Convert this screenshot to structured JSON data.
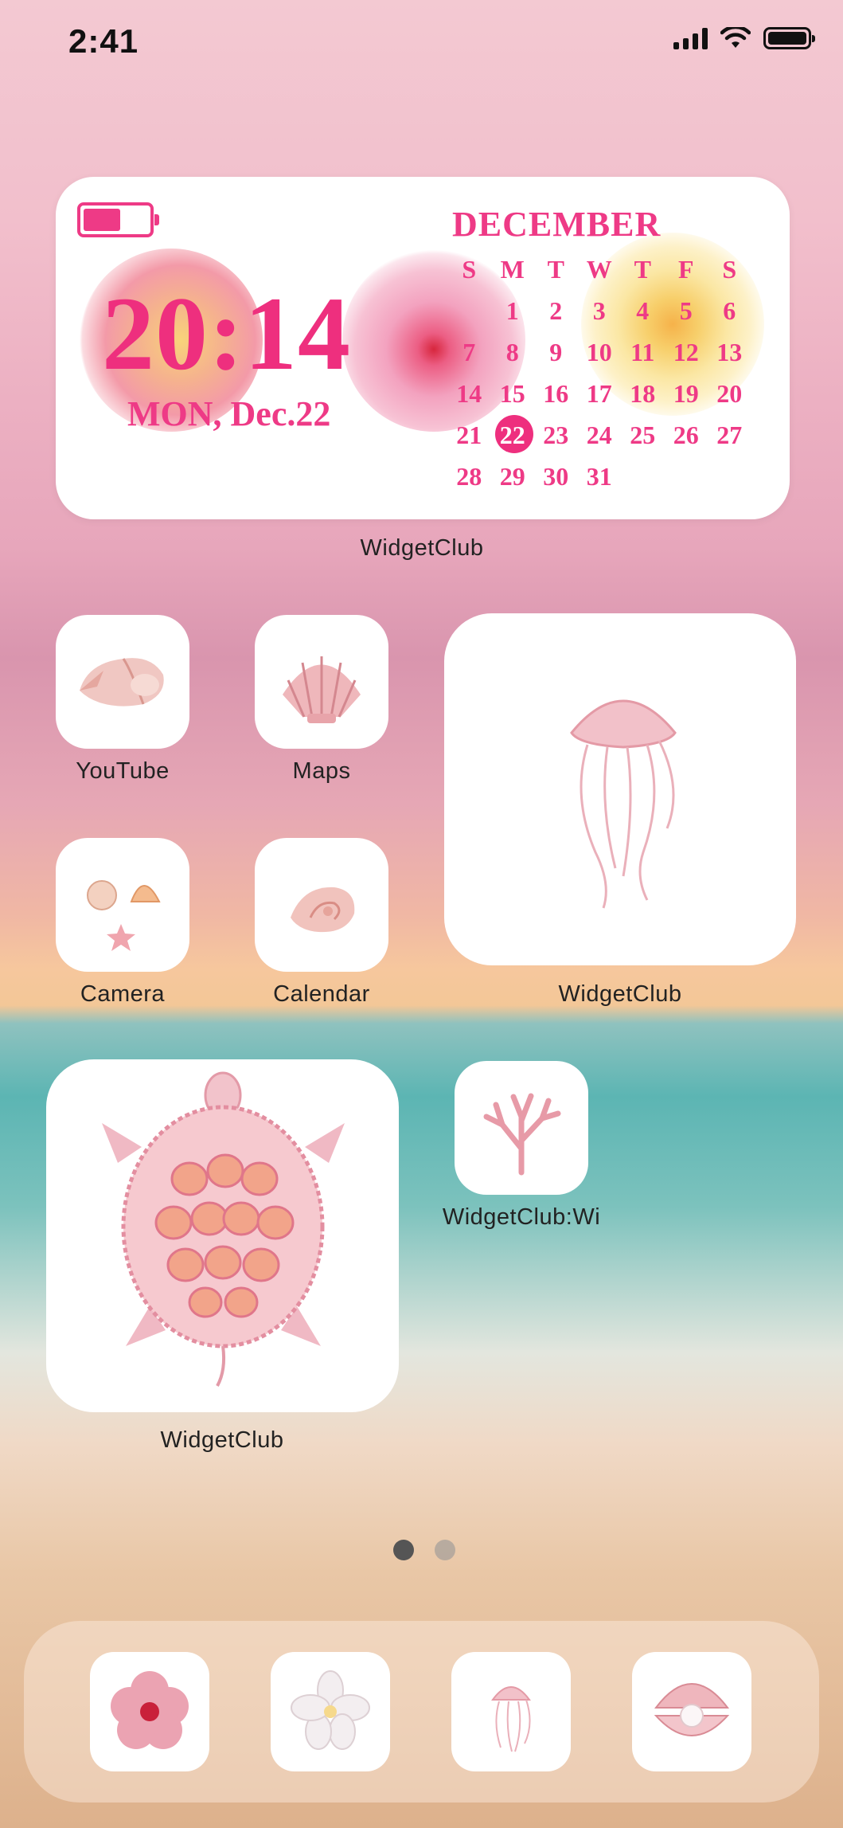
{
  "status_bar": {
    "time": "2:41",
    "icons": [
      "cellular-signal-icon",
      "wifi-icon",
      "battery-icon"
    ]
  },
  "calendar_widget": {
    "clock": "20:14",
    "date": "MON, Dec.22",
    "month": "DECEMBER",
    "weekdays": [
      "S",
      "M",
      "T",
      "W",
      "T",
      "F",
      "S"
    ],
    "days": [
      "",
      "1",
      "2",
      "3",
      "4",
      "5",
      "6",
      "7",
      "8",
      "9",
      "10",
      "11",
      "12",
      "13",
      "14",
      "15",
      "16",
      "17",
      "18",
      "19",
      "20",
      "21",
      "22",
      "23",
      "24",
      "25",
      "26",
      "27",
      "28",
      "29",
      "30",
      "31",
      "",
      "",
      ""
    ],
    "today": "22",
    "label": "WidgetClub",
    "accent": "#ee3a86"
  },
  "apps": {
    "youtube": {
      "label": "YouTube",
      "icon": "conch-shell-icon"
    },
    "maps": {
      "label": "Maps",
      "icon": "scallop-shell-icon"
    },
    "camera": {
      "label": "Camera",
      "icon": "shells-and-starfish-icon"
    },
    "calendar": {
      "label": "Calendar",
      "icon": "spiral-shell-icon"
    },
    "widgetclub_small": {
      "label": "WidgetClub:Wi",
      "icon": "coral-icon"
    }
  },
  "widgets": {
    "jellyfish": {
      "label": "WidgetClub",
      "icon": "jellyfish-icon"
    },
    "turtle": {
      "label": "WidgetClub",
      "icon": "sea-turtle-icon"
    }
  },
  "page_dots": {
    "count": 2,
    "active": 1
  },
  "dock": [
    "hibiscus-icon",
    "white-flower-icon",
    "jellyfish-icon",
    "pearl-shell-icon"
  ]
}
